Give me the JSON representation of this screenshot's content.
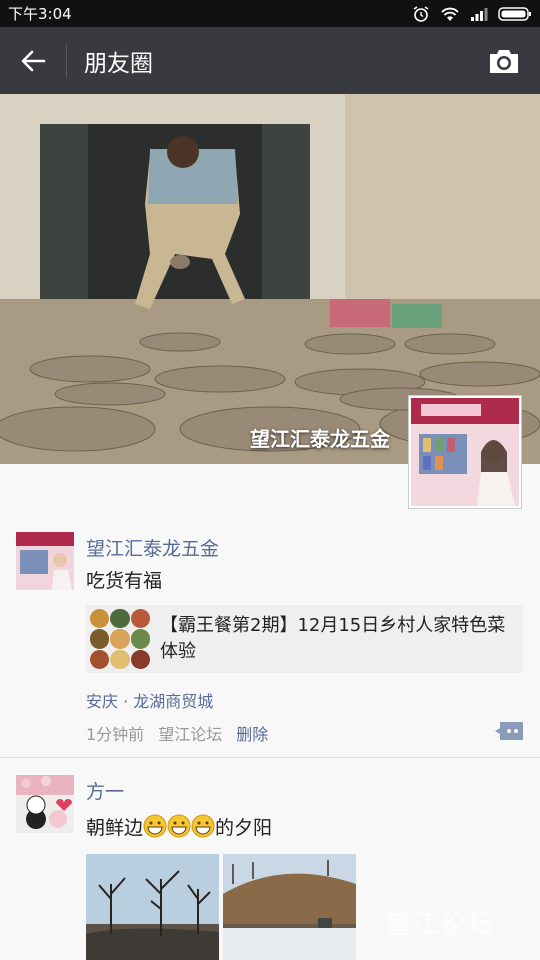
{
  "status_bar": {
    "time": "下午3:04"
  },
  "title_bar": {
    "title": "朋友圈"
  },
  "cover": {
    "name": "望江汇泰龙五金"
  },
  "posts": [
    {
      "author": "望江汇泰龙五金",
      "text": "吃货有福",
      "link_title": "【霸王餐第2期】12月15日乡村人家特色菜体验",
      "location": "安庆 · 龙湖商贸城",
      "time": "1分钟前",
      "source": "望江论坛",
      "delete": "删除"
    },
    {
      "author": "方一",
      "text_before": "朝鲜边",
      "text_after": "的夕阳"
    }
  ],
  "watermark": "望江论坛",
  "colors": {
    "link": "#576b95",
    "title_bar": "#393a3f",
    "status_bar": "#111111"
  }
}
